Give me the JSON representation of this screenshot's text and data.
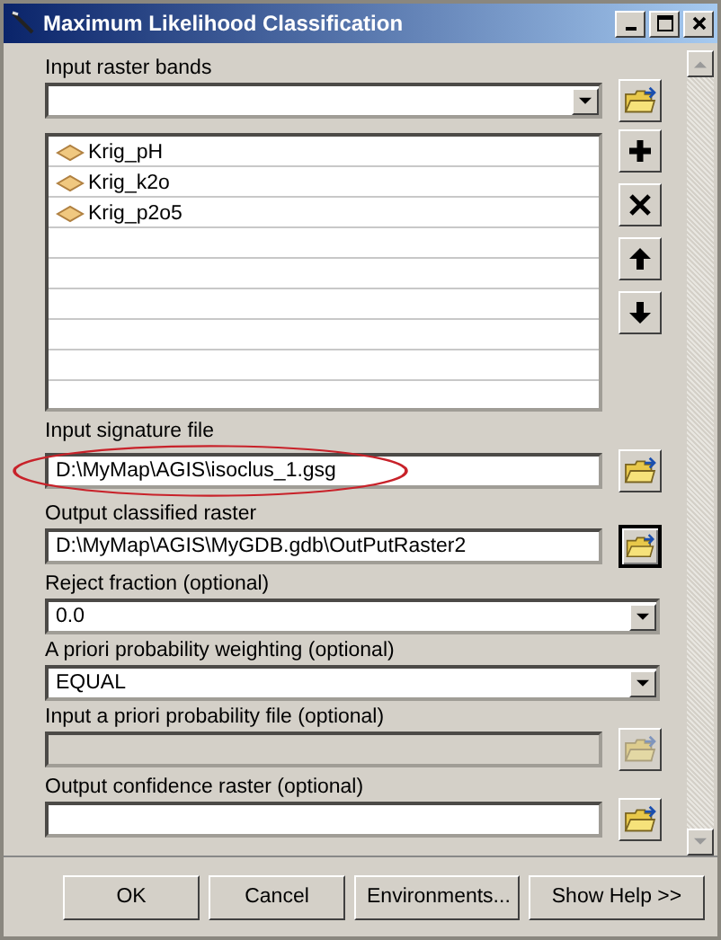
{
  "window": {
    "title": "Maximum Likelihood Classification"
  },
  "params": [
    {
      "kind": "multivalue",
      "label": "Input raster bands",
      "items": [
        "Krig_pH",
        "Krig_k2o",
        "Krig_p2o5"
      ]
    },
    {
      "kind": "file",
      "label": "Input signature file",
      "value": "D:\\MyMap\\AGIS\\isoclus_1.gsg",
      "highlighted": true,
      "disabled": false,
      "focused": false
    },
    {
      "kind": "file",
      "label": "Output classified raster",
      "value": "D:\\MyMap\\AGIS\\MyGDB.gdb\\OutPutRaster2",
      "highlighted": false,
      "disabled": false,
      "focused": true
    },
    {
      "kind": "dropdown",
      "label": "Reject fraction (optional)",
      "value": "0.0"
    },
    {
      "kind": "dropdown",
      "label": "A priori probability weighting (optional)",
      "value": "EQUAL"
    },
    {
      "kind": "file",
      "label": "Input a priori probability file (optional)",
      "highlighted": false,
      "disabled": true,
      "focused": false
    },
    {
      "kind": "file",
      "label": "Output confidence raster (optional)",
      "highlighted": false,
      "disabled": false,
      "focused": false
    }
  ],
  "buttons": [
    "OK",
    "Cancel",
    "Environments...",
    "Show Help >>"
  ]
}
